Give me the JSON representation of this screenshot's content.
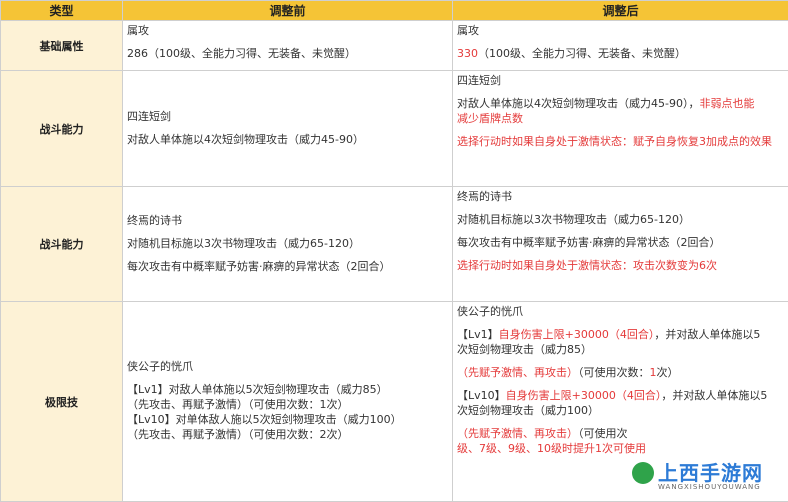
{
  "header": {
    "col_type": "类型",
    "col_before": "调整前",
    "col_after": "调整后"
  },
  "rows": [
    {
      "type": "基础属性",
      "before": {
        "title": "属攻",
        "line1": "286（100级、全能力习得、无装备、未觉醒）"
      },
      "after": {
        "title": "属攻",
        "value": "330",
        "rest": "（100级、全能力习得、无装备、未觉醒）"
      }
    },
    {
      "type": "战斗能力",
      "before": {
        "title": "四连短剑",
        "line1": "对敌人单体施以4次短剑物理攻击（威力45-90）"
      },
      "after": {
        "title": "四连短剑",
        "line1": "对敌人单体施以4次短剑物理攻击（威力45-90），",
        "line1_red": "非弱点也能",
        "line2_red": "减少盾牌点数",
        "line3_red": "选择行动时如果自身处于激情状态：赋予自身恢复3加成点的效果"
      }
    },
    {
      "type": "战斗能力",
      "before": {
        "title": "终焉的诗书",
        "line1": "对随机目标施以3次书物理攻击（威力65-120）",
        "line2": "每次攻击有中概率赋予妨害·麻痹的异常状态（2回合）"
      },
      "after": {
        "title": "终焉的诗书",
        "line1": "对随机目标施以3次书物理攻击（威力65-120）",
        "line2": "每次攻击有中概率赋予妨害·麻痹的异常状态（2回合）",
        "line3_red": "选择行动时如果自身处于激情状态：攻击次数变为6次"
      }
    },
    {
      "type": "极限技",
      "before": {
        "title": "侠公子的恍爪",
        "line1": "【Lv1】对敌人单体施以5次短剑物理攻击（威力85）",
        "line2": "（先攻击、再赋予激情）（可使用次数：1次）",
        "line3": "【Lv10】对单体敌人施以5次短剑物理攻击（威力100）",
        "line4": "（先攻击、再赋予激情）（可使用次数：2次）"
      },
      "after": {
        "title": "侠公子的恍爪",
        "l1a": "【Lv1】",
        "l1b_red": "自身伤害上限+30000（4回合）",
        "l1c": "，并对敌人单体施以5",
        "l2": "次短剑物理攻击（威力85）",
        "l3a_red": "（先赋予激情、再攻击）",
        "l3b": "（可使用次数：",
        "l3c_red": "1",
        "l3d": "次）",
        "l4a": "【Lv10】",
        "l4b_red": "自身伤害上限+30000（4回合）",
        "l4c": "，并对敌人单体施以5",
        "l5": "次短剑物理攻击（威力100）",
        "l6a_red": "（先赋予激情、再攻击）",
        "l6b": "（可使用次",
        "l7_red": "级、7级、9级、10级时提升1次可使用"
      }
    }
  ],
  "watermark": {
    "title": "上西手游网",
    "sub": "WANGXISHOUYOUWANG"
  },
  "colors": {
    "header_bg": "#f5c436",
    "type_bg": "#fdf2d6",
    "highlight": "#e43a3a"
  }
}
